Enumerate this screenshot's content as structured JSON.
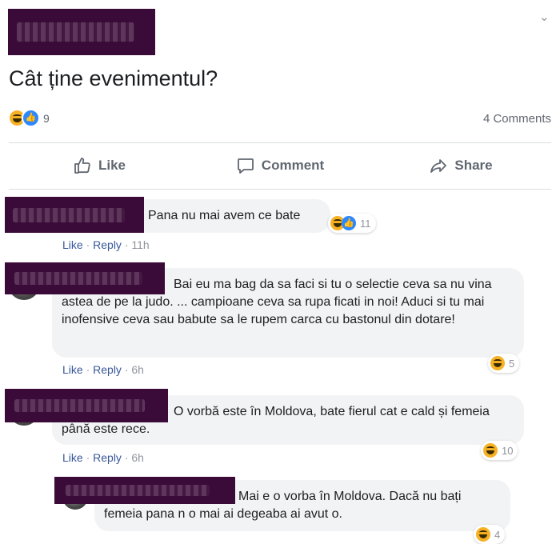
{
  "post": {
    "title": "Cât ține evenimentul?",
    "reaction_count": "9",
    "comments_count": "4 Comments",
    "menu_icon": "chevron-down-icon"
  },
  "actions": {
    "like": "Like",
    "comment": "Comment",
    "share": "Share"
  },
  "comments": [
    {
      "text": "Pana nu mai avem ce bate",
      "like": "Like",
      "reply": "Reply",
      "time": "11h",
      "reactions": "11"
    },
    {
      "text": "Bai eu ma bag da sa faci si tu o selectie ceva sa nu vina astea de pe la judo. ... campioane ceva sa rupa ficati in noi! Aduci si tu mai inofensive ceva sau babute sa le rupem carca cu bastonul din dotare!",
      "like": "Like",
      "reply": "Reply",
      "time": "6h",
      "reactions": "5"
    },
    {
      "text": "O vorbă este în Moldova, bate fierul cat e cald și femeia până este rece.",
      "like": "Like",
      "reply": "Reply",
      "time": "6h",
      "reactions": "10"
    },
    {
      "text": "Mai e o vorba în Moldova. Dacă nu bați femeia pana n o mai ai degeaba ai avut o.",
      "reactions": "4"
    }
  ],
  "sep": " · "
}
